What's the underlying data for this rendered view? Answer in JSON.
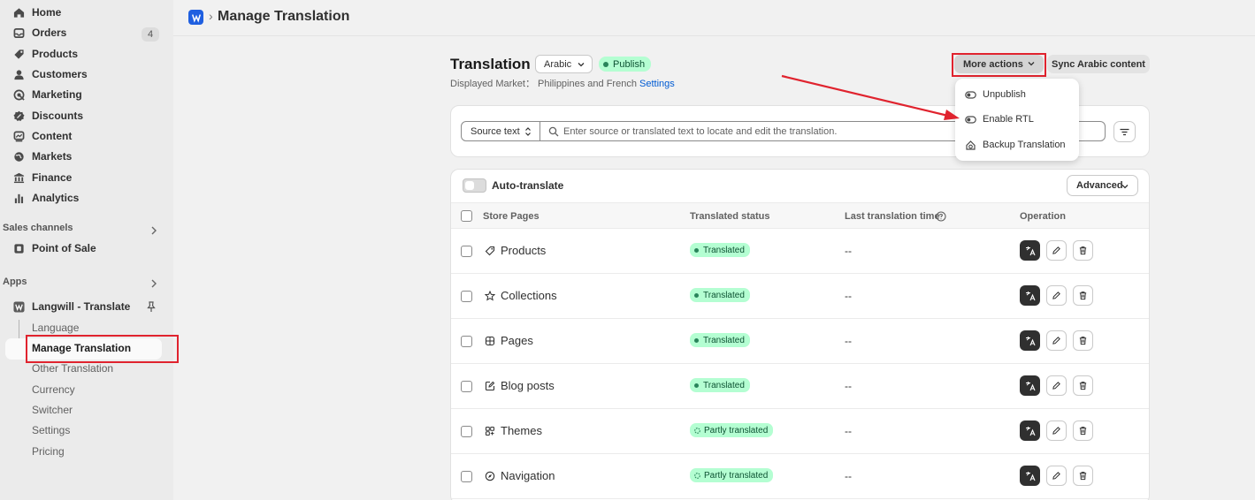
{
  "sidebar": {
    "nav": [
      {
        "label": "Home",
        "icon": "home-icon"
      },
      {
        "label": "Orders",
        "icon": "inbox-icon",
        "badge": "4"
      },
      {
        "label": "Products",
        "icon": "tag-icon"
      },
      {
        "label": "Customers",
        "icon": "person-icon"
      },
      {
        "label": "Marketing",
        "icon": "target-icon"
      },
      {
        "label": "Discounts",
        "icon": "discount-icon"
      },
      {
        "label": "Content",
        "icon": "content-icon"
      },
      {
        "label": "Markets",
        "icon": "globe-icon"
      },
      {
        "label": "Finance",
        "icon": "bank-icon"
      },
      {
        "label": "Analytics",
        "icon": "bar-chart-icon"
      }
    ],
    "sales_channels_label": "Sales channels",
    "point_of_sale": "Point of Sale",
    "apps_label": "Apps",
    "app_name": "Langwill - Translate",
    "app_sub": [
      "Language",
      "Manage Translation",
      "Other Translation",
      "Currency",
      "Switcher",
      "Settings",
      "Pricing"
    ]
  },
  "topbar": {
    "title": "Manage Translation"
  },
  "heading": {
    "title": "Translation",
    "language": "Arabic",
    "status": "Publish",
    "market_prefix": "Displayed Market： Philippines and French",
    "settings_link": "Settings",
    "more_actions": "More actions",
    "sync": "Sync Arabic content"
  },
  "dropdown": {
    "items": [
      "Unpublish",
      "Enable RTL",
      "Backup Translation"
    ]
  },
  "search": {
    "source_select": "Source text",
    "placeholder": "Enter source or translated text to locate and edit the translation."
  },
  "table": {
    "auto_translate": "Auto-translate",
    "advanced": "Advanced",
    "headers": [
      "Store Pages",
      "Translated status",
      "Last translation time",
      "Operation"
    ],
    "rows": [
      {
        "name": "Products",
        "status": "Translated",
        "time": "--"
      },
      {
        "name": "Collections",
        "status": "Translated",
        "time": "--"
      },
      {
        "name": "Pages",
        "status": "Translated",
        "time": "--"
      },
      {
        "name": "Blog posts",
        "status": "Translated",
        "time": "--"
      },
      {
        "name": "Themes",
        "status": "Partly translated",
        "time": "--"
      },
      {
        "name": "Navigation",
        "status": "Partly translated",
        "time": "--"
      }
    ]
  },
  "colors": {
    "accent_blue": "#005bd3",
    "badge_green": "#b4fed2",
    "annotation_red": "#e0232e"
  }
}
